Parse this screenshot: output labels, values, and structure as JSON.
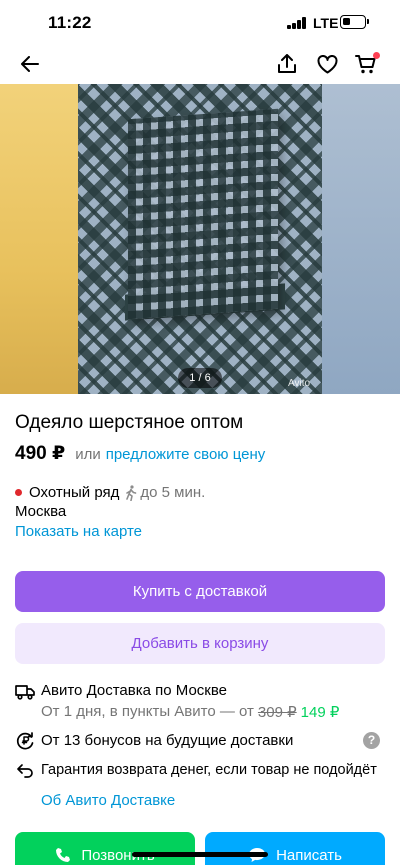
{
  "status_bar": {
    "time": "11:22",
    "network": "LTE"
  },
  "nav": {
    "back_icon": "arrow-left-icon",
    "share_icon": "share-icon",
    "favorite_icon": "heart-icon",
    "cart_icon": "cart-icon",
    "cart_badge_color": "#ff4053"
  },
  "gallery": {
    "counter": "1 / 6",
    "watermark": "Avito"
  },
  "product": {
    "title": "Одеяло шерстяное оптом",
    "price": "490 ₽",
    "price_or": "или",
    "offer_link": "предложите свою цену"
  },
  "location": {
    "metro": "Охотный ряд",
    "metro_color": "#e0282d",
    "walk_time": "до 5 мин.",
    "city": "Москва",
    "map_link": "Показать на карте"
  },
  "actions": {
    "buy_label": "Купить с доставкой",
    "cart_label": "Добавить в корзину"
  },
  "delivery": {
    "title": "Авито Доставка по Москве",
    "subtitle_prefix": "От 1 дня, в пункты Авито — от",
    "old_price": "309 ₽",
    "new_price": "149 ₽",
    "bonus": "От 13 бонусов на будущие доставки",
    "help": "?",
    "guarantee": "Гарантия возврата денег, если товар не подойдёт",
    "about_link": "Об Авито Доставке"
  },
  "bottom": {
    "call_label": "Позвонить",
    "write_label": "Написать"
  },
  "colors": {
    "accent_purple": "#965eeb",
    "link_blue": "#0096d6",
    "green": "#02d15c",
    "write_blue": "#00aaff"
  }
}
